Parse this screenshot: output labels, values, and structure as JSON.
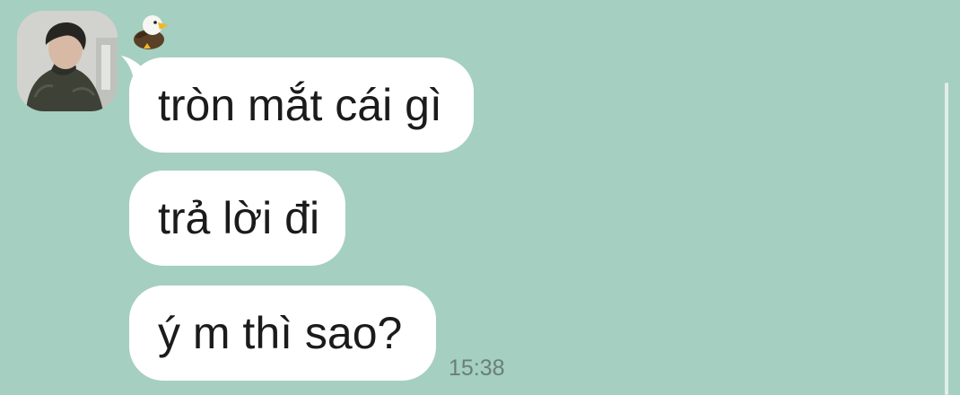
{
  "conversation": {
    "sender": {
      "avatar_icon": "user-avatar",
      "badge_icon": "eagle-icon"
    },
    "messages": [
      {
        "text": "tròn mắt cái gì"
      },
      {
        "text": "trả lời đi"
      },
      {
        "text": "ý m thì sao?"
      }
    ],
    "timestamp": "15:38"
  },
  "colors": {
    "background": "#a5cfc1",
    "bubble": "#ffffff",
    "text": "#1b1b1b",
    "timestamp": "#6a7e77"
  }
}
